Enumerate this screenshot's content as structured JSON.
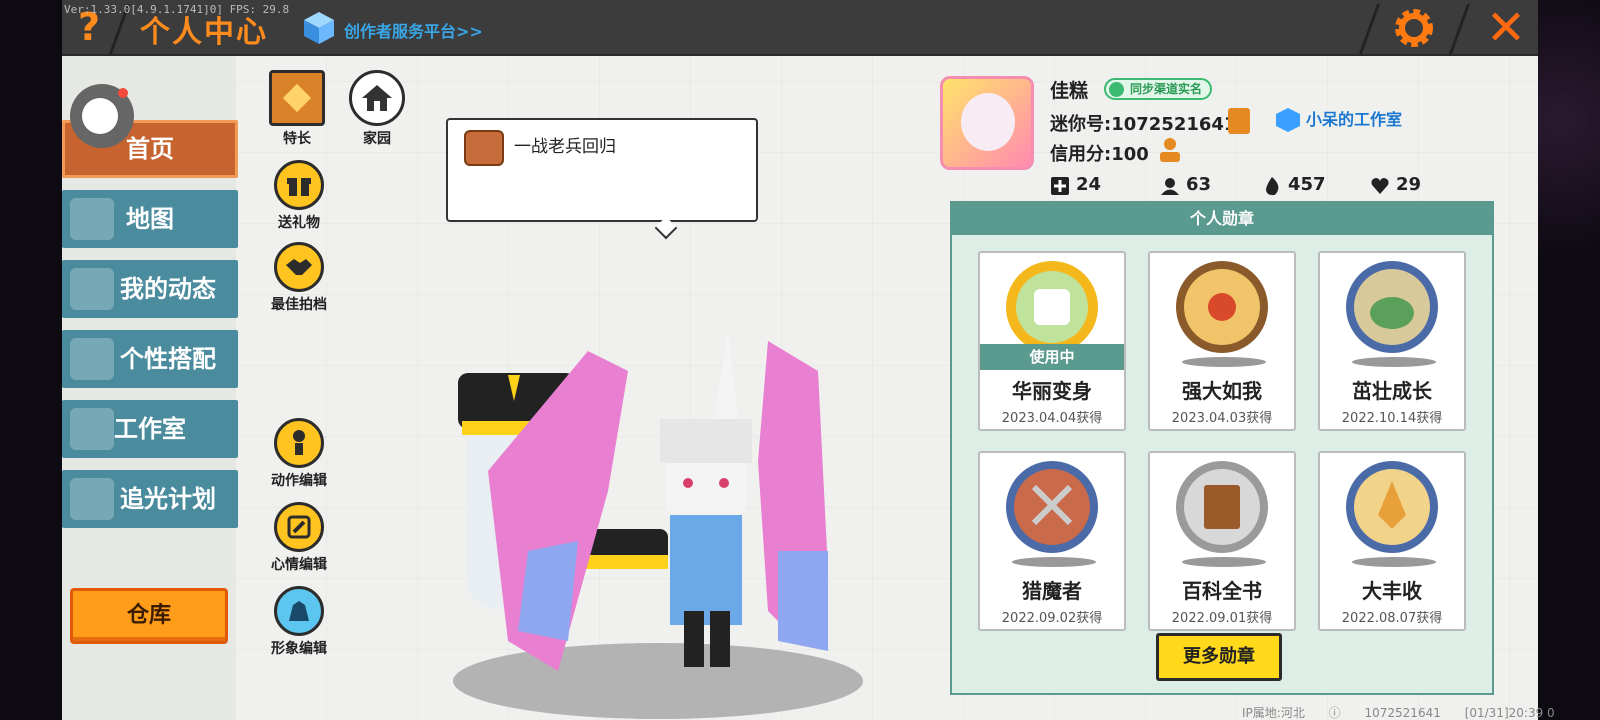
{
  "debug_text": "Ver:1.33.0[4.9.1.1741]0] FPS: 29.8",
  "header": {
    "help_label": "?",
    "title": "个人中心",
    "creator_link": "创作者服务平台>>",
    "close_label": "✕"
  },
  "sidebar": {
    "items": [
      {
        "label": "首页",
        "active": true
      },
      {
        "label": "地图"
      },
      {
        "label": "我的动态"
      },
      {
        "label": "个性搭配"
      },
      {
        "label": "工作室"
      },
      {
        "label": "追光计划"
      }
    ],
    "warehouse_label": "仓库"
  },
  "functions": {
    "specialty": "特长",
    "home": "家园",
    "gift": "送礼物",
    "partner": "最佳拍档",
    "action_edit": "动作编辑",
    "mood_edit": "心情编辑",
    "appearance_edit": "形象编辑"
  },
  "bubble": {
    "text": "一战老兵回归"
  },
  "profile": {
    "name": "佳糕",
    "verify_badge": "同步渠道实名",
    "mini_id": "迷你号:1072521641",
    "studio": "小呆的工作室",
    "credit": "信用分:100",
    "stats": [
      {
        "icon": "plus-box-icon",
        "value": "24"
      },
      {
        "icon": "fans-icon",
        "value": "63"
      },
      {
        "icon": "fire-icon",
        "value": "457"
      },
      {
        "icon": "heart-icon",
        "value": "29"
      }
    ]
  },
  "medals": {
    "title": "个人勋章",
    "using_label": "使用中",
    "items": [
      {
        "name": "华丽变身",
        "date": "2023.04.04获得",
        "using": true,
        "color": "#f5b81c"
      },
      {
        "name": "强大如我",
        "date": "2023.04.03获得",
        "color": "#d88a3a"
      },
      {
        "name": "茁壮成长",
        "date": "2022.10.14获得",
        "color": "#4a6aa8"
      },
      {
        "name": "猎魔者",
        "date": "2022.09.02获得",
        "color": "#4a6aa8"
      },
      {
        "name": "百科全书",
        "date": "2022.09.01获得",
        "color": "#9a9a9a"
      },
      {
        "name": "大丰收",
        "date": "2022.08.07获得",
        "color": "#4a6aa8"
      }
    ],
    "more_label": "更多勋章"
  },
  "footer": {
    "ip": "IP属地:河北",
    "uid": "1072521641",
    "time": "[01/31]20:39 0"
  },
  "colors": {
    "accent": "#ff8a1d",
    "nav": "#4a8b9e",
    "active_nav": "#c6632f",
    "medal_header": "#5b9a8e"
  }
}
